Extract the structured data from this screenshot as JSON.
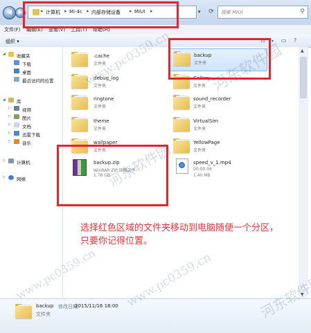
{
  "address_bar": {
    "breadcrumbs": [
      "计算机",
      "Mi-4c",
      "内部存储设备",
      "MIUI"
    ],
    "search_placeholder": "搜索 MIUI"
  },
  "menu": [
    "文件(F)",
    "编辑(E)",
    "查看(V)",
    "工具(T)",
    "帮助(H)"
  ],
  "toolbar": {
    "organize": "组织"
  },
  "nav_pane": {
    "favorites": {
      "label": "收藏夹",
      "items": [
        "下载",
        "桌面",
        "最近访问的位置"
      ]
    },
    "libraries": {
      "label": "库",
      "items": [
        "视频",
        "图片",
        "文档",
        "迅雷下载",
        "音乐"
      ]
    },
    "computer": "计算机",
    "network": "网络"
  },
  "files": [
    {
      "name": ".cache",
      "type": "文件夹"
    },
    {
      "name": "backup",
      "type": "文件夹"
    },
    {
      "name": "debug_log",
      "type": "文件夹"
    },
    {
      "name": "Gallery",
      "type": "文件夹"
    },
    {
      "name": "ringtone",
      "type": "文件夹"
    },
    {
      "name": "sound_recorder",
      "type": "文件夹"
    },
    {
      "name": "theme",
      "type": "文件夹"
    },
    {
      "name": "VirtualSim",
      "type": "文件夹"
    },
    {
      "name": "wallpaper",
      "type": "文件夹"
    },
    {
      "name": "YellowPage",
      "type": "文件夹"
    },
    {
      "name": "backup.zip",
      "type": "WinRAR ZIP 压缩文件",
      "size": "1.78 GB"
    },
    {
      "name": "speed_v_1.mp4",
      "type": "00:00:06",
      "size": "1.40 MB"
    }
  ],
  "instruction": {
    "line1": "选择红色区域的文件夹移动到电脑随便一个分区，",
    "line2": "只要你记得位置。"
  },
  "details": {
    "name": "backup",
    "modified_label": "修改日期:",
    "modified": "2015/11/16 18:00",
    "type": "文件夹"
  },
  "watermark": {
    "text": "河东软件园",
    "url": "www.pc0359.cn"
  },
  "colors": {
    "highlight_red": "#e8222a",
    "instruction_red": "#e8323a",
    "selection": "#cfe4fb"
  }
}
